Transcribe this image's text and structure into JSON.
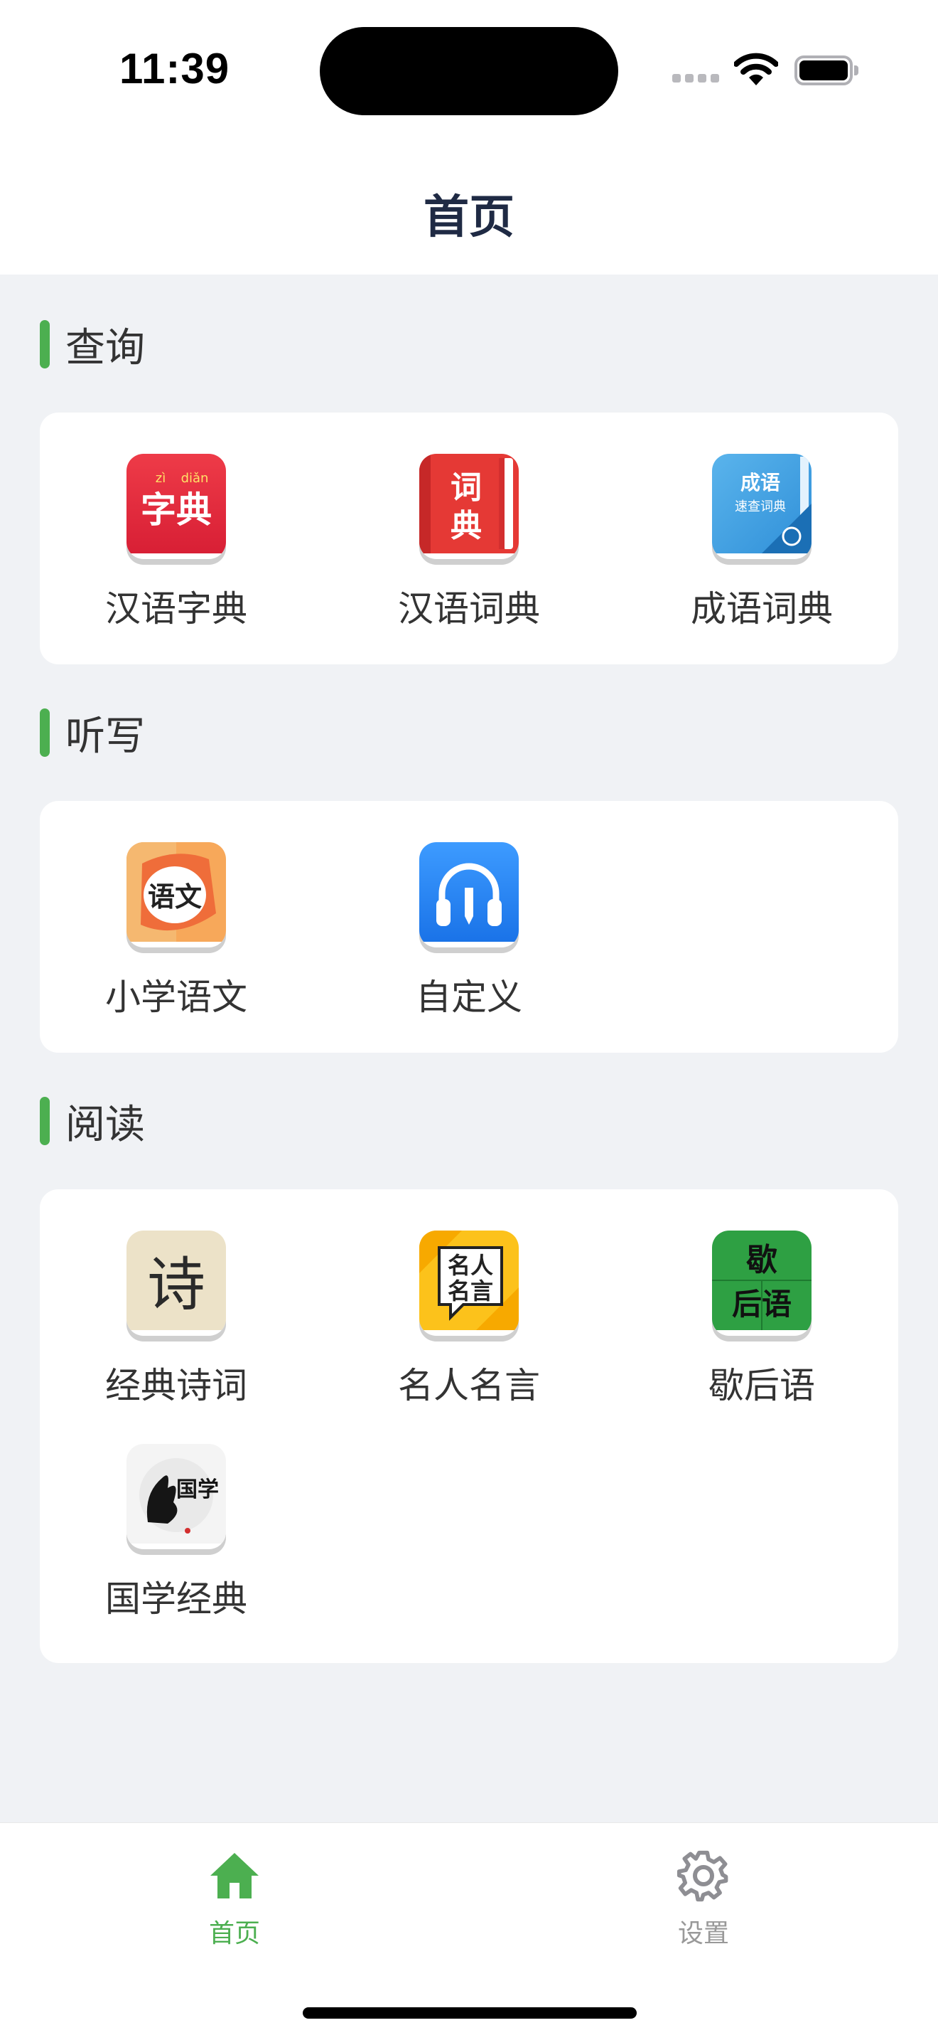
{
  "status_bar": {
    "time": "11:39"
  },
  "nav": {
    "title": "首页"
  },
  "sections": [
    {
      "title": "查询",
      "items": [
        {
          "label": "汉语字典",
          "icon": "zidian-icon"
        },
        {
          "label": "汉语词典",
          "icon": "cidian-icon"
        },
        {
          "label": "成语词典",
          "icon": "chengyu-icon"
        }
      ]
    },
    {
      "title": "听写",
      "items": [
        {
          "label": "小学语文",
          "icon": "yuwen-icon"
        },
        {
          "label": "自定义",
          "icon": "headphones-icon"
        }
      ]
    },
    {
      "title": "阅读",
      "items": [
        {
          "label": "经典诗词",
          "icon": "poetry-icon"
        },
        {
          "label": "名人名言",
          "icon": "quotes-icon"
        },
        {
          "label": "歇后语",
          "icon": "xiehouyu-icon"
        },
        {
          "label": "国学经典",
          "icon": "guoxue-icon"
        }
      ]
    }
  ],
  "icon_text": {
    "zidian_pinyin_1": "zì",
    "zidian_pinyin_2": "diǎn",
    "zidian_chars": "字典",
    "cidian_char_1": "词",
    "cidian_char_2": "典",
    "chengyu_title": "成语",
    "chengyu_sub": "速查词典",
    "yuwen_chars": "语文",
    "poetry_char": "诗",
    "quotes_line_1": "名人",
    "quotes_line_2": "名言",
    "xiehouyu_line_1": "歇",
    "xiehouyu_line_2": "后语",
    "guoxue_chars": "国学"
  },
  "tabs": [
    {
      "label": "首页",
      "icon": "home-icon",
      "active": true
    },
    {
      "label": "设置",
      "icon": "gear-icon",
      "active": false
    }
  ],
  "colors": {
    "accent": "#4caf50",
    "background": "#f0f2f5",
    "title": "#1f2a44",
    "tab_inactive": "#999999"
  }
}
